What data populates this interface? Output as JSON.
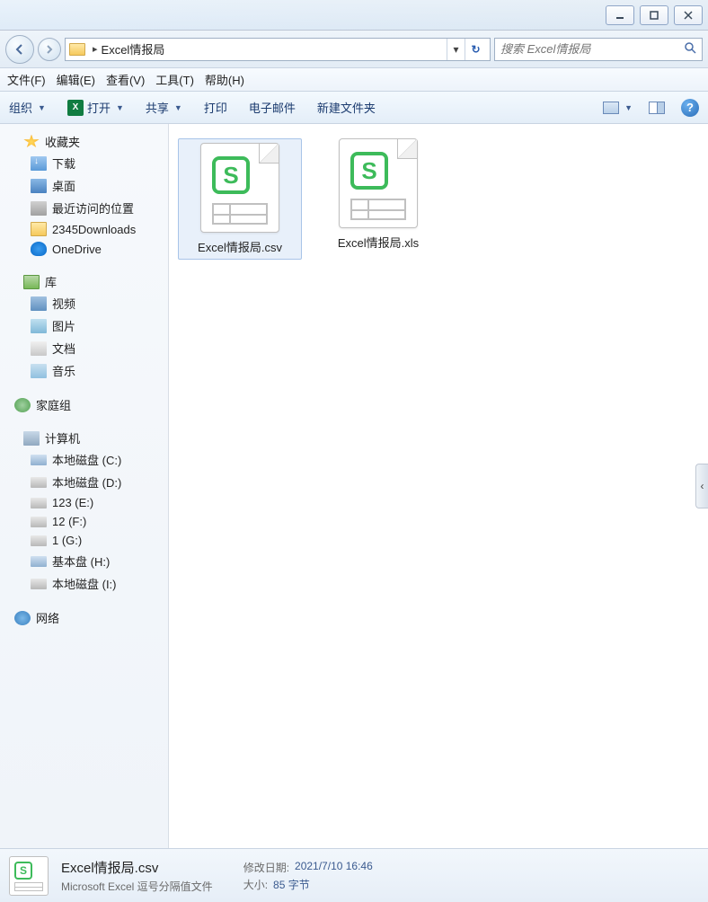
{
  "location": "Excel情报局",
  "search_placeholder": "搜索 Excel情报局",
  "menu": {
    "file": "文件(F)",
    "edit": "编辑(E)",
    "view": "查看(V)",
    "tools": "工具(T)",
    "help": "帮助(H)"
  },
  "toolbar": {
    "organize": "组织",
    "open": "打开",
    "share": "共享",
    "print": "打印",
    "email": "电子邮件",
    "newfolder": "新建文件夹"
  },
  "sidebar": {
    "favorites": "收藏夹",
    "fav_items": {
      "downloads": "下载",
      "desktop": "桌面",
      "recent": "最近访问的位置",
      "dl2345": "2345Downloads",
      "onedrive": "OneDrive"
    },
    "libraries": "库",
    "lib_items": {
      "video": "视频",
      "pictures": "图片",
      "documents": "文档",
      "music": "音乐"
    },
    "homegroup": "家庭组",
    "computer": "计算机",
    "drives": {
      "c": "本地磁盘 (C:)",
      "d": "本地磁盘 (D:)",
      "e": "123 (E:)",
      "f": "12 (F:)",
      "g": "1 (G:)",
      "h": "基本盘 (H:)",
      "i": "本地磁盘 (I:)"
    },
    "network": "网络"
  },
  "files": {
    "csv": "Excel情报局.csv",
    "xls": "Excel情报局.xls"
  },
  "details": {
    "name": "Excel情报局.csv",
    "type": "Microsoft Excel 逗号分隔值文件",
    "modified_label": "修改日期:",
    "modified": "2021/7/10 16:46",
    "size_label": "大小:",
    "size": "85 字节"
  }
}
